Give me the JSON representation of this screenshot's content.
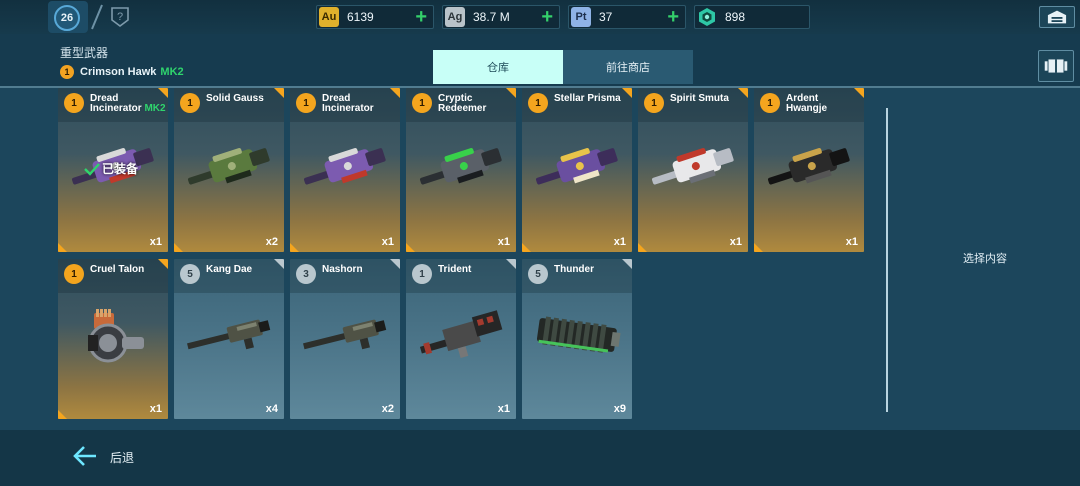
{
  "top_bar": {
    "player_level": "26",
    "currencies": [
      {
        "badge": "Au",
        "value": "6139",
        "color": "#e0b12c"
      },
      {
        "badge": "Ag",
        "value": "38.7 M",
        "color": "#b9c3c9"
      },
      {
        "badge": "Pt",
        "value": "37",
        "color": "#8fb3e6"
      },
      {
        "badge": "",
        "value": "898",
        "color": "#2ec8a6"
      }
    ]
  },
  "header": {
    "category_title": "重型武器",
    "equipped_level": "1",
    "equipped_name": "Crimson Hawk",
    "equipped_mark": "MK2",
    "tabs": [
      {
        "label": "仓库",
        "active": true
      },
      {
        "label": "前往商店",
        "active": false
      }
    ]
  },
  "equipped_label": "已装备",
  "weapons": [
    {
      "level": "1",
      "name": "Dread Incinerator",
      "mark": "MK2",
      "qty": "x1",
      "rarity": "gold",
      "equipped": true,
      "icon": "purple-heavy-gun"
    },
    {
      "level": "1",
      "name": "Solid Gauss",
      "mark": "",
      "qty": "x2",
      "rarity": "gold",
      "equipped": false,
      "icon": "green-rail-cannon"
    },
    {
      "level": "1",
      "name": "Dread Incinerator",
      "mark": "",
      "qty": "x1",
      "rarity": "gold",
      "equipped": false,
      "icon": "purple-heavy-gun"
    },
    {
      "level": "1",
      "name": "Cryptic Redeemer",
      "mark": "",
      "qty": "x1",
      "rarity": "gold",
      "equipped": false,
      "icon": "green-plasma-gun"
    },
    {
      "level": "1",
      "name": "Stellar Prisma",
      "mark": "",
      "qty": "x1",
      "rarity": "gold",
      "equipped": false,
      "icon": "gold-purple-lance"
    },
    {
      "level": "1",
      "name": "Spirit Smuta",
      "mark": "",
      "qty": "x1",
      "rarity": "gold",
      "equipped": false,
      "icon": "silver-red-blaster"
    },
    {
      "level": "1",
      "name": "Ardent Hwangje",
      "mark": "",
      "qty": "x1",
      "rarity": "gold",
      "equipped": false,
      "icon": "black-gold-cannon"
    },
    {
      "level": "1",
      "name": "Cruel Talon",
      "mark": "",
      "qty": "x1",
      "rarity": "gold",
      "equipped": false,
      "icon": "ammo-drum-launcher"
    },
    {
      "level": "5",
      "name": "Kang Dae",
      "mark": "",
      "qty": "x4",
      "rarity": "blue",
      "equipped": false,
      "icon": "long-barrel-gun"
    },
    {
      "level": "3",
      "name": "Nashorn",
      "mark": "",
      "qty": "x2",
      "rarity": "blue",
      "equipped": false,
      "icon": "long-barrel-gun"
    },
    {
      "level": "1",
      "name": "Trident",
      "mark": "",
      "qty": "x1",
      "rarity": "blue",
      "equipped": false,
      "icon": "boxy-red-gun"
    },
    {
      "level": "5",
      "name": "Thunder",
      "mark": "",
      "qty": "x9",
      "rarity": "blue",
      "equipped": false,
      "icon": "ribbed-heavy-cannon"
    }
  ],
  "detail_panel": {
    "hint": "选择内容"
  },
  "footer": {
    "back_label": "后退"
  }
}
